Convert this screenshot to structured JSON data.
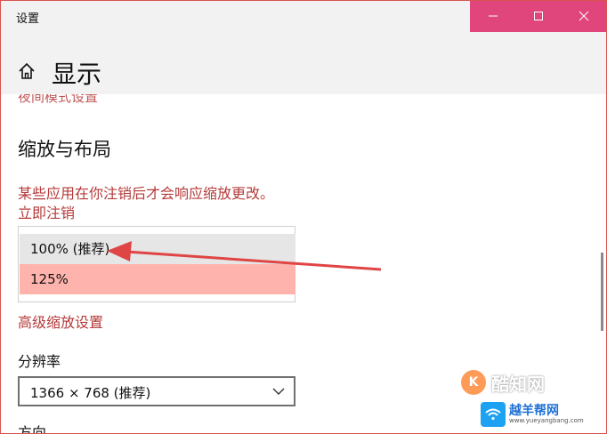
{
  "window": {
    "title": "设置",
    "controls": {
      "minimize_icon": "minimize-icon",
      "maximize_icon": "maximize-icon",
      "close_icon": "close-icon"
    },
    "controls_color": "#e0457b"
  },
  "header": {
    "home_icon": "home-icon",
    "title": "显示"
  },
  "content": {
    "night_mode_link": "夜间模式设置",
    "scale_section": {
      "title": "缩放与布局",
      "warning": "某些应用在你注销后才会响应缩放更改。",
      "signout_link": "立即注销",
      "scale_options": [
        "100% (推荐)",
        "125%"
      ],
      "selected_option": "100% (推荐)",
      "highlighted_option": "125%",
      "advanced_link": "高级缩放设置"
    },
    "resolution": {
      "label": "分辨率",
      "value": "1366 × 768 (推荐)"
    },
    "orientation": {
      "label": "方向"
    }
  },
  "colors": {
    "accent_link": "#b53a3a",
    "highlight": "#ffb3ad",
    "selected": "#e6e6e6"
  },
  "watermarks": {
    "wm1_text": "酷知网",
    "wm2_cn": "越羊帮网",
    "wm2_en": "www.yueyangbang.com"
  }
}
